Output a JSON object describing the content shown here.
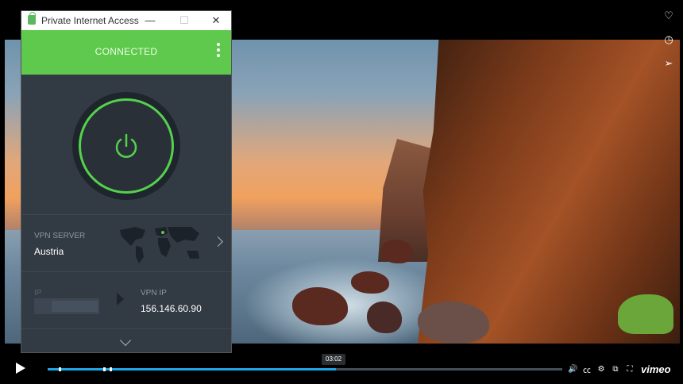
{
  "pia": {
    "title": "Private Internet Access",
    "status": "CONNECTED",
    "window_buttons": {
      "minimize": "—",
      "maximize": "☐",
      "close": "✕"
    },
    "vpn_server_label": "VPN SERVER",
    "vpn_server_value": "Austria",
    "ip_label": "IP",
    "vpn_ip_label": "VPN IP",
    "vpn_ip_value": "156.146.60.90",
    "accent_color": "#5ec94c"
  },
  "player": {
    "time_tooltip": "03:02",
    "progress_fraction": 0.56,
    "brand": "vimeo",
    "side_icons": [
      "heart-icon",
      "clock-icon",
      "share-icon"
    ],
    "control_icons": [
      "volume-icon",
      "captions-icon",
      "settings-icon",
      "pip-icon",
      "fullscreen-icon"
    ],
    "accent_color": "#1ea7e8"
  }
}
